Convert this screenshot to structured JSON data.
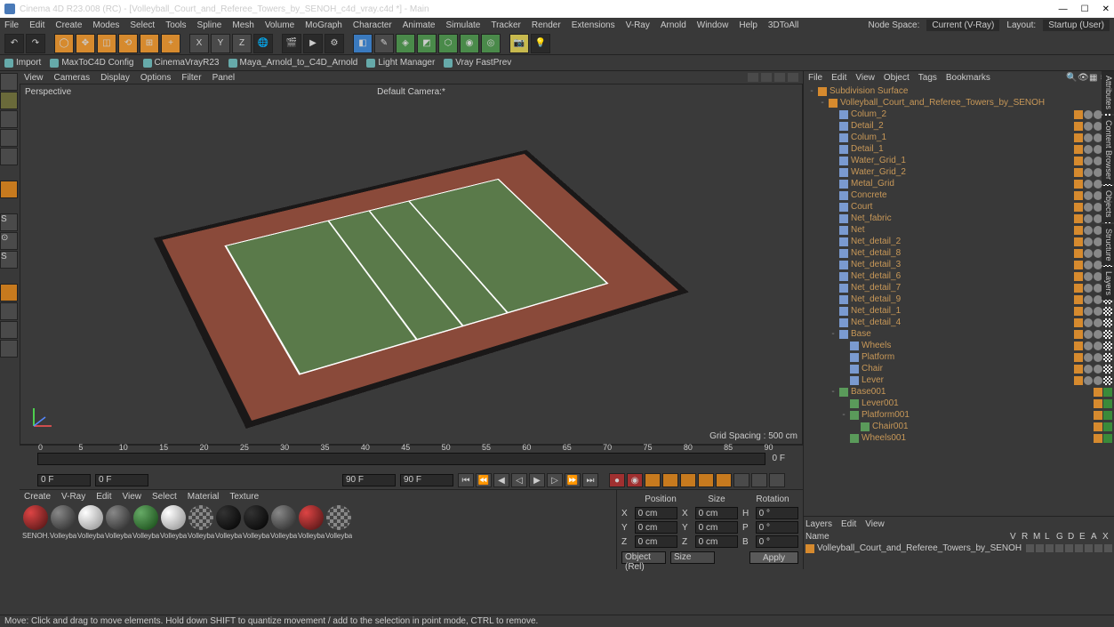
{
  "title": "Cinema 4D R23.008 (RC) - [Volleyball_Court_and_Referee_Towers_by_SENOH_c4d_vray.c4d *] - Main",
  "menubar": {
    "items": [
      "File",
      "Edit",
      "Create",
      "Modes",
      "Select",
      "Tools",
      "Spline",
      "Mesh",
      "Volume",
      "MoGraph",
      "Character",
      "Animate",
      "Simulate",
      "Tracker",
      "Render",
      "Extensions",
      "V-Ray",
      "Arnold",
      "Window",
      "Help",
      "3DToAll"
    ],
    "nodespace": "Node Space:",
    "nodespace_val": "Current (V-Ray)",
    "layout": "Layout:",
    "layout_val": "Startup (User)"
  },
  "toolbar2": {
    "items": [
      "Import",
      "MaxToC4D Config",
      "CinemaVrayR23",
      "Maya_Arnold_to_C4D_Arnold",
      "Light Manager",
      "Vray FastPrev"
    ]
  },
  "vpmenu": {
    "items": [
      "View",
      "Cameras",
      "Display",
      "Options",
      "Filter",
      "Panel"
    ]
  },
  "viewport": {
    "tl": "Perspective",
    "tc": "Default Camera:*",
    "br": "Grid Spacing : 500 cm"
  },
  "timeline": {
    "ticks": [
      "0",
      "5",
      "10",
      "15",
      "20",
      "25",
      "30",
      "35",
      "40",
      "45",
      "50",
      "55",
      "60",
      "65",
      "70",
      "75",
      "80",
      "85",
      "90"
    ]
  },
  "frames": {
    "start": "0 F",
    "cur": "0 F",
    "end": "90 F",
    "end2": "90 F",
    "right": "0 F"
  },
  "matmenu": [
    "Create",
    "V-Ray",
    "Edit",
    "View",
    "Select",
    "Material",
    "Texture"
  ],
  "materials": [
    {
      "label": "SENOH.",
      "cls": "red"
    },
    {
      "label": "Volleyba",
      "cls": ""
    },
    {
      "label": "Volleyba",
      "cls": "white"
    },
    {
      "label": "Volleyba",
      "cls": ""
    },
    {
      "label": "Volleyba",
      "cls": "green"
    },
    {
      "label": "Volleyba",
      "cls": "white"
    },
    {
      "label": "Volleyba",
      "cls": "check"
    },
    {
      "label": "Volleyba",
      "cls": "dark"
    },
    {
      "label": "Volleyba",
      "cls": "dark"
    },
    {
      "label": "Volleyba",
      "cls": ""
    },
    {
      "label": "Volleyba",
      "cls": "red"
    },
    {
      "label": "Volleyba",
      "cls": "check"
    }
  ],
  "coord": {
    "hdr": [
      "Position",
      "Size",
      "Rotation"
    ],
    "rows": [
      [
        "X",
        "0 cm",
        "X",
        "0 cm",
        "H",
        "0 °"
      ],
      [
        "Y",
        "0 cm",
        "Y",
        "0 cm",
        "P",
        "0 °"
      ],
      [
        "Z",
        "0 cm",
        "Z",
        "0 cm",
        "B",
        "0 °"
      ]
    ],
    "sel1": "Object (Rel)",
    "sel2": "Size",
    "apply": "Apply"
  },
  "rpmenu": [
    "File",
    "Edit",
    "View",
    "Object",
    "Tags",
    "Bookmarks"
  ],
  "tree": [
    {
      "d": 0,
      "e": "-",
      "i": "orange",
      "n": "Subdivision Surface",
      "t": []
    },
    {
      "d": 1,
      "e": "-",
      "i": "orange",
      "n": "Volleyball_Court_and_Referee_Towers_by_SENOH",
      "t": [
        "o"
      ]
    },
    {
      "d": 2,
      "e": "",
      "i": "",
      "n": "Colum_2",
      "t": [
        "o",
        "g",
        "g",
        "c"
      ]
    },
    {
      "d": 2,
      "e": "",
      "i": "",
      "n": "Detail_2",
      "t": [
        "o",
        "g",
        "g",
        "c"
      ]
    },
    {
      "d": 2,
      "e": "",
      "i": "",
      "n": "Colum_1",
      "t": [
        "o",
        "g",
        "g",
        "c"
      ]
    },
    {
      "d": 2,
      "e": "",
      "i": "",
      "n": "Detail_1",
      "t": [
        "o",
        "g",
        "g",
        "c"
      ]
    },
    {
      "d": 2,
      "e": "",
      "i": "",
      "n": "Water_Grid_1",
      "t": [
        "o",
        "g",
        "g",
        "c"
      ]
    },
    {
      "d": 2,
      "e": "",
      "i": "",
      "n": "Water_Grid_2",
      "t": [
        "o",
        "g",
        "g",
        "c"
      ]
    },
    {
      "d": 2,
      "e": "",
      "i": "",
      "n": "Metal_Grid",
      "t": [
        "o",
        "g",
        "g",
        "c"
      ]
    },
    {
      "d": 2,
      "e": "",
      "i": "",
      "n": "Concrete",
      "t": [
        "o",
        "g",
        "g",
        "c"
      ]
    },
    {
      "d": 2,
      "e": "",
      "i": "",
      "n": "Court",
      "t": [
        "o",
        "g",
        "g",
        "c"
      ]
    },
    {
      "d": 2,
      "e": "",
      "i": "",
      "n": "Net_fabric",
      "t": [
        "o",
        "g",
        "g",
        "c"
      ]
    },
    {
      "d": 2,
      "e": "",
      "i": "",
      "n": "Net",
      "t": [
        "o",
        "g",
        "g",
        "c"
      ]
    },
    {
      "d": 2,
      "e": "",
      "i": "",
      "n": "Net_detail_2",
      "t": [
        "o",
        "g",
        "g",
        "c"
      ]
    },
    {
      "d": 2,
      "e": "",
      "i": "",
      "n": "Net_detail_8",
      "t": [
        "o",
        "g",
        "g",
        "c"
      ]
    },
    {
      "d": 2,
      "e": "",
      "i": "",
      "n": "Net_detail_3",
      "t": [
        "o",
        "g",
        "g",
        "c"
      ]
    },
    {
      "d": 2,
      "e": "",
      "i": "",
      "n": "Net_detail_6",
      "t": [
        "o",
        "g",
        "g",
        "c"
      ]
    },
    {
      "d": 2,
      "e": "",
      "i": "",
      "n": "Net_detail_7",
      "t": [
        "o",
        "g",
        "g",
        "c"
      ]
    },
    {
      "d": 2,
      "e": "",
      "i": "",
      "n": "Net_detail_9",
      "t": [
        "o",
        "g",
        "g",
        "c"
      ]
    },
    {
      "d": 2,
      "e": "",
      "i": "",
      "n": "Net_detail_1",
      "t": [
        "o",
        "g",
        "g",
        "c"
      ]
    },
    {
      "d": 2,
      "e": "",
      "i": "",
      "n": "Net_detail_4",
      "t": [
        "o",
        "g",
        "g",
        "c"
      ]
    },
    {
      "d": 2,
      "e": "-",
      "i": "",
      "n": "Base",
      "t": [
        "o",
        "g",
        "g",
        "c"
      ]
    },
    {
      "d": 3,
      "e": "",
      "i": "",
      "n": "Wheels",
      "t": [
        "o",
        "g",
        "g",
        "c"
      ]
    },
    {
      "d": 3,
      "e": "",
      "i": "",
      "n": "Platform",
      "t": [
        "o",
        "g",
        "g",
        "c"
      ]
    },
    {
      "d": 3,
      "e": "",
      "i": "",
      "n": "Chair",
      "t": [
        "o",
        "g",
        "g",
        "c"
      ]
    },
    {
      "d": 3,
      "e": "",
      "i": "",
      "n": "Lever",
      "t": [
        "o",
        "g",
        "g",
        "c"
      ]
    },
    {
      "d": 2,
      "e": "-",
      "i": "green",
      "n": "Base001",
      "t": [
        "o",
        "gr"
      ]
    },
    {
      "d": 3,
      "e": "",
      "i": "green",
      "n": "Lever001",
      "t": [
        "o",
        "gr"
      ]
    },
    {
      "d": 3,
      "e": "-",
      "i": "green",
      "n": "Platform001",
      "t": [
        "o",
        "gr"
      ]
    },
    {
      "d": 4,
      "e": "",
      "i": "green",
      "n": "Chair001",
      "t": [
        "o",
        "gr"
      ]
    },
    {
      "d": 3,
      "e": "",
      "i": "green",
      "n": "Wheels001",
      "t": [
        "o",
        "gr"
      ]
    }
  ],
  "layers": {
    "menu": [
      "Layers",
      "Edit",
      "View"
    ],
    "name": "Name",
    "flags": [
      "V",
      "R",
      "M",
      "L",
      "G",
      "D",
      "E",
      "A",
      "X"
    ],
    "row": "Volleyball_Court_and_Referee_Towers_by_SENOH"
  },
  "status": "Move: Click and drag to move elements. Hold down SHIFT to quantize movement / add to the selection in point mode, CTRL to remove.",
  "rtabs": [
    "Attributes",
    "Content Browser",
    "Objects",
    "Structure",
    "Layers"
  ]
}
